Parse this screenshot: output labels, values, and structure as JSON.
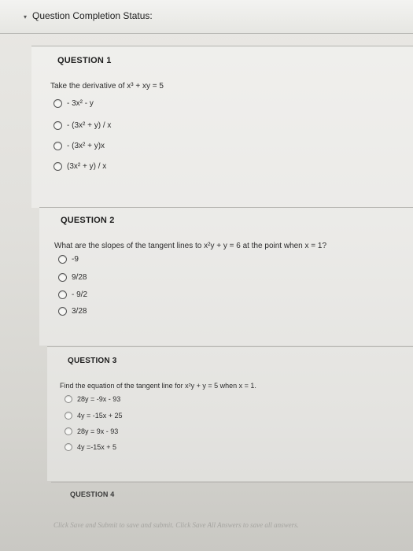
{
  "status": {
    "toggle_glyph": "▾",
    "title": "Question Completion Status:"
  },
  "questions": [
    {
      "header": "QUESTION 1",
      "prompt": "Take the derivative of x³ + xy = 5",
      "options": [
        "- 3x² - y",
        "- (3x² + y) / x",
        "- (3x² + y)x",
        "(3x² + y) / x"
      ]
    },
    {
      "header": "QUESTION 2",
      "prompt": "What are the slopes of the tangent lines to x²y + y = 6  at the point when x = 1?",
      "options": [
        "-9",
        "9/28",
        "- 9/2",
        "3/28"
      ]
    },
    {
      "header": "QUESTION 3",
      "prompt": "Find the equation of the tangent line for x²y + y = 5 when x = 1.",
      "options": [
        "28y = -9x - 93",
        "4y = -15x + 25",
        "28y = 9x - 93",
        "4y =-15x + 5"
      ]
    },
    {
      "header": "QUESTION 4"
    }
  ],
  "footer": {
    "note": "Click Save and Submit to save and submit. Click Save All Answers to save all answers."
  }
}
